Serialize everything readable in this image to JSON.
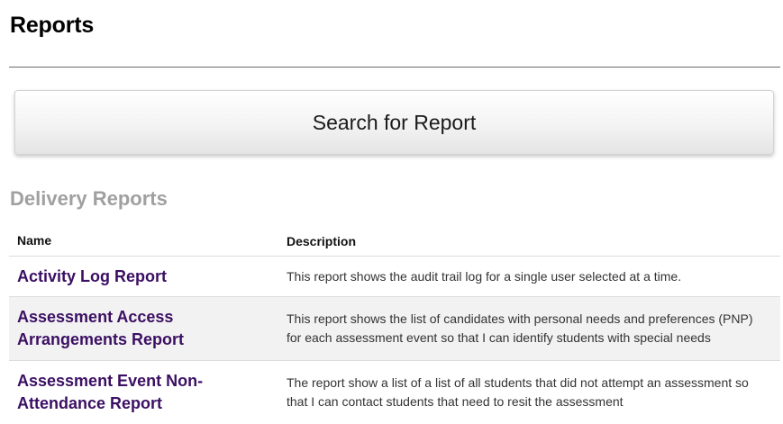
{
  "page": {
    "title": "Reports"
  },
  "search": {
    "button_label": "Search for Report"
  },
  "section": {
    "heading": "Delivery Reports"
  },
  "table": {
    "headers": {
      "name": "Name",
      "description": "Description"
    },
    "rows": [
      {
        "name": "Activity Log Report",
        "description": "This report shows the audit trail log for a single user selected at a time."
      },
      {
        "name": "Assessment Access Arrangements Report",
        "description": "This report shows the list of candidates with personal needs and preferences (PNP) for each assessment event so that I can identify students with special needs"
      },
      {
        "name": "Assessment Event Non-Attendance Report",
        "description": "The report show a list of a list of all students that did not attempt an assessment so that I can contact students that need to resit the assessment"
      }
    ]
  },
  "colors": {
    "link": "#3b0f63",
    "section_heading": "#a0a0a0",
    "alt_row": "#f2f2f2"
  }
}
